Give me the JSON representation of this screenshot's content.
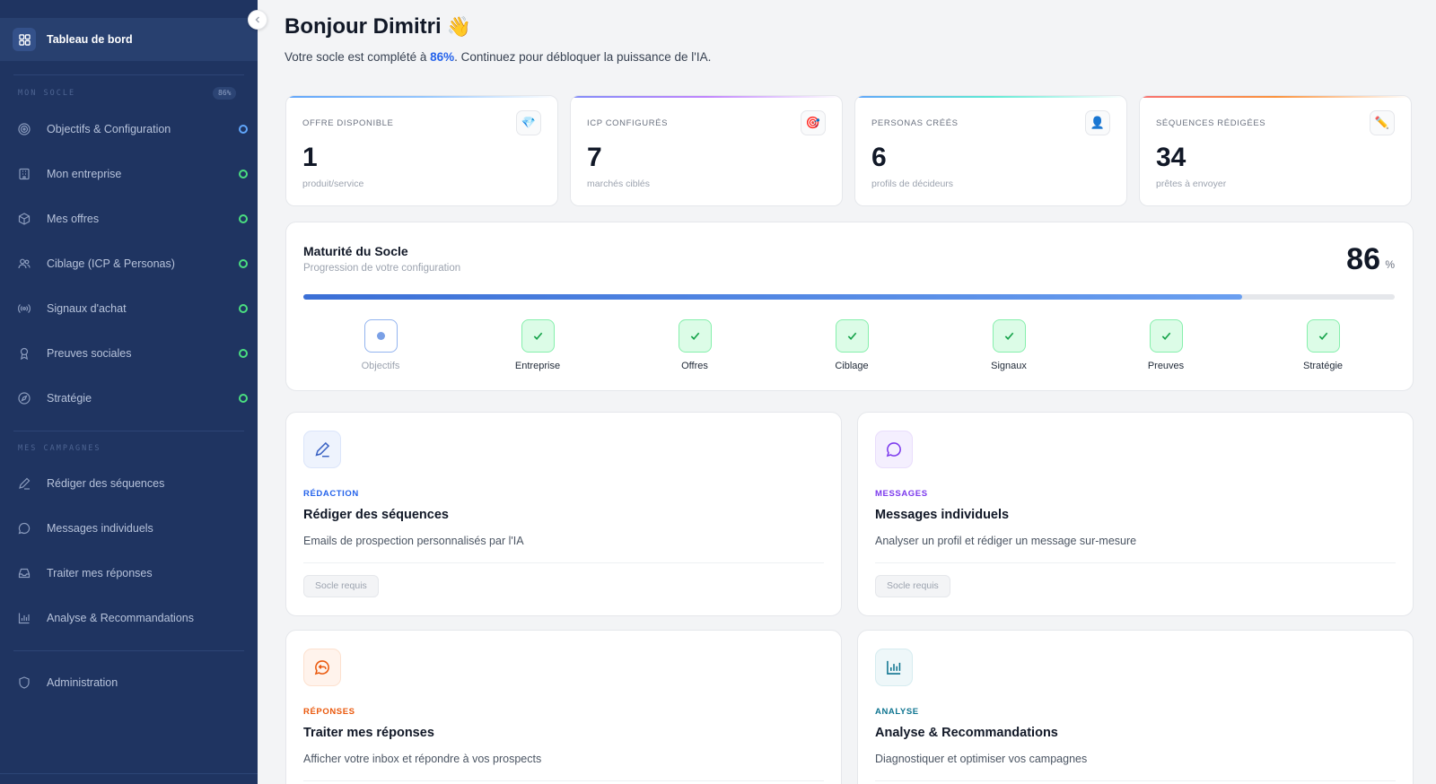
{
  "sidebar": {
    "active_item": {
      "label": "Tableau de bord",
      "icon": "dashboard-grid-icon"
    },
    "section_socle": {
      "title": "MON SOCLE",
      "badge": "86%"
    },
    "socle_items": [
      {
        "label": "Objectifs & Configuration",
        "icon": "target-icon",
        "status": "in-progress"
      },
      {
        "label": "Mon entreprise",
        "icon": "building-icon",
        "status": "done"
      },
      {
        "label": "Mes offres",
        "icon": "box-icon",
        "status": "done"
      },
      {
        "label": "Ciblage (ICP & Personas)",
        "icon": "users-icon",
        "status": "done"
      },
      {
        "label": "Signaux d'achat",
        "icon": "radio-signal-icon",
        "status": "done"
      },
      {
        "label": "Preuves sociales",
        "icon": "award-icon",
        "status": "done"
      },
      {
        "label": "Stratégie",
        "icon": "compass-icon",
        "status": "done"
      }
    ],
    "section_campagnes": {
      "title": "MES CAMPAGNES"
    },
    "campagne_items": [
      {
        "label": "Rédiger des séquences",
        "icon": "pencil-icon"
      },
      {
        "label": "Messages individuels",
        "icon": "chat-bubble-icon"
      },
      {
        "label": "Traiter mes réponses",
        "icon": "inbox-icon"
      },
      {
        "label": "Analyse & Recommandations",
        "icon": "bar-chart-icon"
      }
    ],
    "admin_item": {
      "label": "Administration",
      "icon": "shield-icon"
    }
  },
  "header": {
    "greeting": "Bonjour Dimitri",
    "wave_emoji": "👋",
    "subtitle_before": "Votre socle est complété à ",
    "subtitle_pct": "86%",
    "subtitle_after": ". Continuez pour débloquer la puissance de l'IA."
  },
  "stats": [
    {
      "label": "OFFRE DISPONIBLE",
      "value": "1",
      "sub": "produit/service",
      "icon": "💎",
      "accent": "#60a5fa"
    },
    {
      "label": "ICP CONFIGURÉS",
      "value": "7",
      "sub": "marchés ciblés",
      "icon": "🎯",
      "accent": "#a78bfa"
    },
    {
      "label": "PERSONAS CRÉÉS",
      "value": "6",
      "sub": "profils de décideurs",
      "icon": "👤",
      "accent": "#5eead4"
    },
    {
      "label": "SÉQUENCES RÉDIGÉES",
      "value": "34",
      "sub": "prêtes à envoyer",
      "icon": "✏️",
      "accent": "#fb923c"
    }
  ],
  "maturity": {
    "title": "Maturité du Socle",
    "subtitle": "Progression de votre configuration",
    "value": "86",
    "unit": "%",
    "progress_fraction": 0.86,
    "steps": [
      {
        "label": "Objectifs",
        "status": "current"
      },
      {
        "label": "Entreprise",
        "status": "done"
      },
      {
        "label": "Offres",
        "status": "done"
      },
      {
        "label": "Ciblage",
        "status": "done"
      },
      {
        "label": "Signaux",
        "status": "done"
      },
      {
        "label": "Preuves",
        "status": "done"
      },
      {
        "label": "Stratégie",
        "status": "done"
      }
    ]
  },
  "modules": [
    {
      "tag": "RÉDACTION",
      "tag_color": "#2563eb",
      "title": "Rédiger des séquences",
      "desc": "Emails de prospection personnalisés par l'IA",
      "badge": "Socle requis",
      "icon": "pencil-icon",
      "icon_color": "#3b63c4",
      "icon_bg": "#eef3fd"
    },
    {
      "tag": "MESSAGES",
      "tag_color": "#7c3aed",
      "title": "Messages individuels",
      "desc": "Analyser un profil et rédiger un message sur-mesure",
      "badge": "Socle requis",
      "icon": "chat-bubble-icon",
      "icon_color": "#7c3aed",
      "icon_bg": "#f4effe"
    },
    {
      "tag": "RÉPONSES",
      "tag_color": "#ea580c",
      "title": "Traiter mes réponses",
      "desc": "Afficher votre inbox et répondre à vos prospects",
      "icon": "reply-chat-icon",
      "icon_color": "#ea580c",
      "icon_bg": "#fff3ec"
    },
    {
      "tag": "ANALYSE",
      "tag_color": "#0e7490",
      "title": "Analyse & Recommandations",
      "desc": "Diagnostiquer et optimiser vos campagnes",
      "icon": "bar-chart-icon",
      "icon_color": "#0e7490",
      "icon_bg": "#eef7f9"
    }
  ]
}
